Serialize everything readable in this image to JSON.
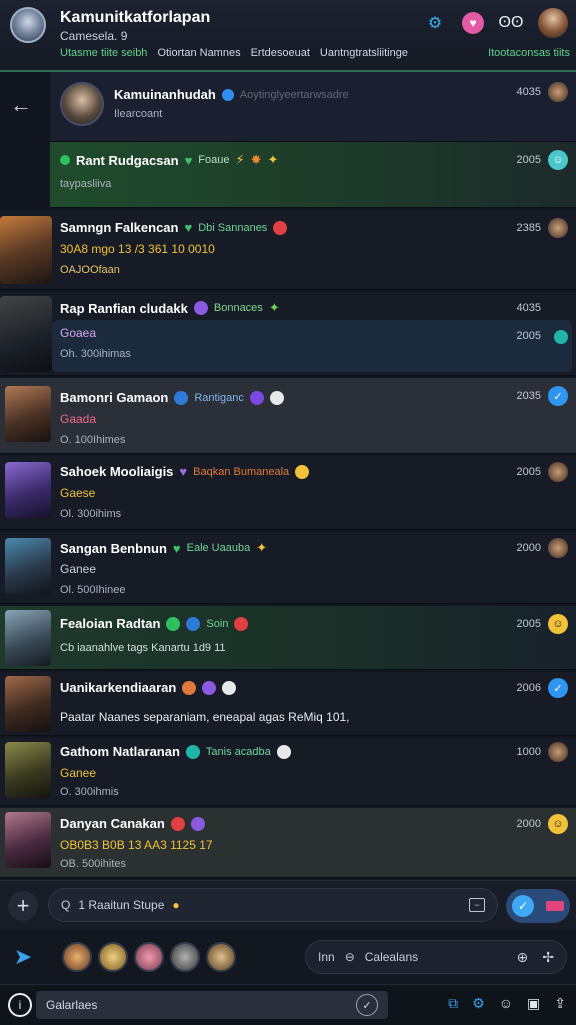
{
  "header": {
    "title": "Kamunitkatforlapan",
    "subtitle": "Camesela. 9",
    "tabs": [
      "Utasme tiite seibh",
      "Otiortan Namnes",
      "Ertdesoeuat",
      "Uantngtratsliitinge",
      "Itootaconsas tiits"
    ],
    "icons": [
      "network-icon",
      "heart-icon",
      "sound-icon",
      "profile-icon"
    ]
  },
  "chats": [
    {
      "name": "Kamuinanhudah",
      "sub": "Ilearcoant",
      "time": "4035",
      "meta": "Aoytinglyeertarwsadre"
    },
    {
      "name": "Rant Rudgacsan",
      "tag": "Foaue",
      "sub": "taypasliiva",
      "time": "2005"
    },
    {
      "name": "Samngn Falkencan",
      "tag": "Dbi  Sannanes",
      "msg": "30A8 mgo 13 /3 361 10 0010",
      "sub": "OAJOOfaan",
      "time": "2385"
    },
    {
      "name": "Rap Ranfian cludakk",
      "tag": "Bonnaces",
      "msg": "Goaea",
      "sub": "Oh. 300ihimas",
      "time": "4035",
      "time2": "2005"
    },
    {
      "name": "Bamonri Gamaon",
      "tag": "Rantiganc",
      "msg": "Gaada",
      "sub": "O. 100Ihimes",
      "time": "2035"
    },
    {
      "name": "Sahoek Mooliaigis",
      "tag": "Baqkan  Bumaneala",
      "msg": "Gaese",
      "sub": "Ol. 300ihims",
      "time": "2005"
    },
    {
      "name": "Sangan Benbnun",
      "tag": "Eale  Uaauba",
      "msg": "Ganee",
      "sub": "Ol. 500Ihinee",
      "time": "2000"
    },
    {
      "name": "Fealoian Radtan",
      "tag": "Soin",
      "sub": "Cb iaanahlve  tags Kanartu 1d9 11",
      "time": "2005"
    },
    {
      "name": "Uanikarkendiaaran",
      "msg": "Paatar Naanes  separaniam, eneapal agas  ReMiq 101,",
      "time": "2006"
    },
    {
      "name": "Gathom Natlaranan",
      "tag": "Tanis  acadba",
      "msg": "Ganee",
      "sub": "O. 300ihmis",
      "time": "1000"
    },
    {
      "name": "Danyan Canakan",
      "msg": "OB0B3 B0B 13 AA3 1125 17",
      "sub": "OB. 500ihites",
      "time": "2000"
    }
  ],
  "composer": {
    "placeholder": "1 Raaitun Stupe"
  },
  "search": {
    "label": "Calealans",
    "prefix": "Inn"
  },
  "bottom": {
    "input": "Galarlaes"
  }
}
